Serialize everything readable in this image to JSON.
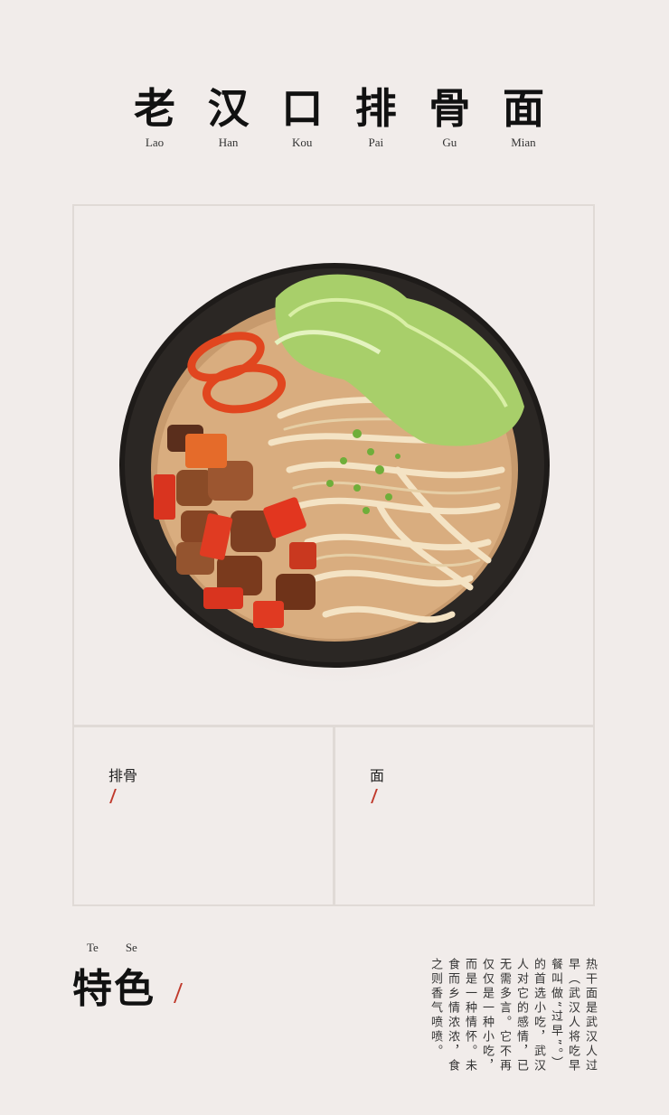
{
  "title": {
    "chars": [
      {
        "zh": "老",
        "py": "Lao"
      },
      {
        "zh": "汉",
        "py": "Han"
      },
      {
        "zh": "口",
        "py": "Kou"
      },
      {
        "zh": "排",
        "py": "Pai"
      },
      {
        "zh": "骨",
        "py": "Gu"
      },
      {
        "zh": "面",
        "py": "Mian"
      }
    ]
  },
  "ingredients": [
    {
      "label": "排骨"
    },
    {
      "label": "面"
    }
  ],
  "feature": {
    "heading": "特色",
    "pinyin": [
      "Te",
      "Se"
    ],
    "body": "热干面是武汉人过早（武汉人将吃早餐叫做“过早”。）的首选小吃，武汉人对它的感情，已无需多言。它不再仅仅是一种小吃，而是一种情怀。未食而乡情浓浓，食之则香气喷喷。"
  },
  "colors": {
    "background": "#f1ecea",
    "accent_slash": "#c0392b",
    "panel_border": "#e0dad6"
  }
}
